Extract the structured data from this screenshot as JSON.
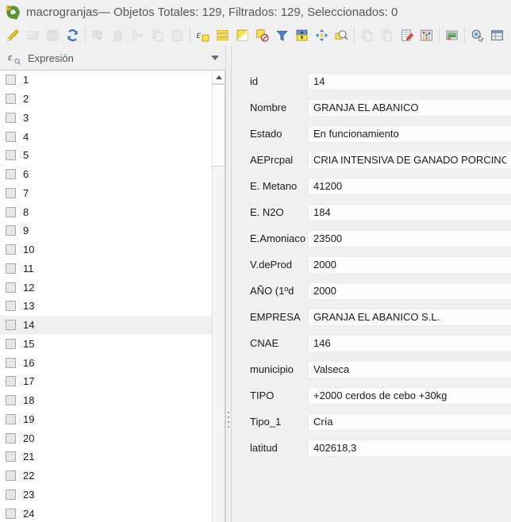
{
  "window": {
    "title": "macrogranjas— Objetos Totales: 129, Filtrados: 129, Seleccionados: 0"
  },
  "toolbar": {
    "buttons": [
      {
        "name": "toggle-editing",
        "icon": "pencil-yellow",
        "enabled": true
      },
      {
        "name": "multiedit",
        "icon": "pencil-lines",
        "enabled": false
      },
      {
        "name": "save-edits",
        "icon": "floppy",
        "enabled": false
      },
      {
        "name": "reload",
        "icon": "refresh",
        "enabled": true
      },
      {
        "type": "separator"
      },
      {
        "name": "add-feature",
        "icon": "table-arrow",
        "enabled": false
      },
      {
        "name": "delete-selected",
        "icon": "trash",
        "enabled": false
      },
      {
        "name": "cut-features",
        "icon": "scissors",
        "enabled": false
      },
      {
        "name": "copy-features",
        "icon": "copy",
        "enabled": false
      },
      {
        "name": "paste-features",
        "icon": "paste",
        "enabled": false
      },
      {
        "type": "separator"
      },
      {
        "name": "select-by-expression",
        "icon": "epsilon-square",
        "enabled": true
      },
      {
        "name": "select-all",
        "icon": "bars-yellow",
        "enabled": true
      },
      {
        "name": "invert-selection",
        "icon": "invert-square",
        "enabled": true
      },
      {
        "name": "deselect-all",
        "icon": "deselect",
        "enabled": true
      },
      {
        "name": "filter-select",
        "icon": "funnel",
        "enabled": true
      },
      {
        "name": "move-selection-top",
        "icon": "move-top",
        "enabled": true
      },
      {
        "name": "pan-to-selection",
        "icon": "pan-arrows",
        "enabled": true
      },
      {
        "name": "zoom-to-selection",
        "icon": "zoom-yellow",
        "enabled": true
      },
      {
        "type": "separator"
      },
      {
        "name": "new-field",
        "icon": "copy",
        "enabled": false
      },
      {
        "name": "delete-field",
        "icon": "copy",
        "enabled": false
      },
      {
        "name": "field-calculator",
        "icon": "notepad-pencil",
        "enabled": true
      },
      {
        "name": "conditional-formatting",
        "icon": "abacus",
        "enabled": true
      },
      {
        "type": "separator"
      },
      {
        "name": "dock-table",
        "icon": "dock-panel",
        "enabled": true
      },
      {
        "type": "separator"
      },
      {
        "name": "search-widget",
        "icon": "magnifier-cursor",
        "enabled": true
      },
      {
        "name": "switch-form-view",
        "icon": "form-table",
        "enabled": true
      }
    ]
  },
  "expression_bar": {
    "label": "Expresión"
  },
  "feature_list": {
    "items": [
      "1",
      "2",
      "3",
      "4",
      "5",
      "6",
      "7",
      "8",
      "9",
      "10",
      "11",
      "12",
      "13",
      "14",
      "15",
      "16",
      "17",
      "18",
      "19",
      "20",
      "21",
      "22",
      "23",
      "24"
    ],
    "selected": "14"
  },
  "form": {
    "fields": [
      {
        "label": "id",
        "value": "14"
      },
      {
        "label": "Nombre",
        "value": "GRANJA EL ABANICO"
      },
      {
        "label": "Estado",
        "value": "En funcionamiento"
      },
      {
        "label": "AEPrcpal",
        "value": "CRIA INTENSIVA DE GANADO PORCINO"
      },
      {
        "label": "E. Metano",
        "value": "41200"
      },
      {
        "label": "E. N2O",
        "value": "184"
      },
      {
        "label": "E.Amoniaco",
        "value": "23500"
      },
      {
        "label": "V.deProd",
        "value": "2000"
      },
      {
        "label": "AÑO (1ºd",
        "value": "2000"
      },
      {
        "label": "EMPRESA",
        "value": "GRANJA EL ABANICO S.L."
      },
      {
        "label": "CNAE",
        "value": "146"
      },
      {
        "label": "municipio",
        "value": "Valseca"
      },
      {
        "label": "TIPO",
        "value": "+2000 cerdos de cebo +30kg"
      },
      {
        "label": "Tipo_1",
        "value": "Cría"
      },
      {
        "label": "latitud",
        "value": "402618,3"
      }
    ]
  },
  "colors": {
    "accent_yellow": "#f6e24b",
    "accent_blue": "#4a7fc9",
    "qgis_green": "#589632",
    "panel_bg": "#f0f0f0",
    "selection_bg": "#f0f0f0"
  }
}
